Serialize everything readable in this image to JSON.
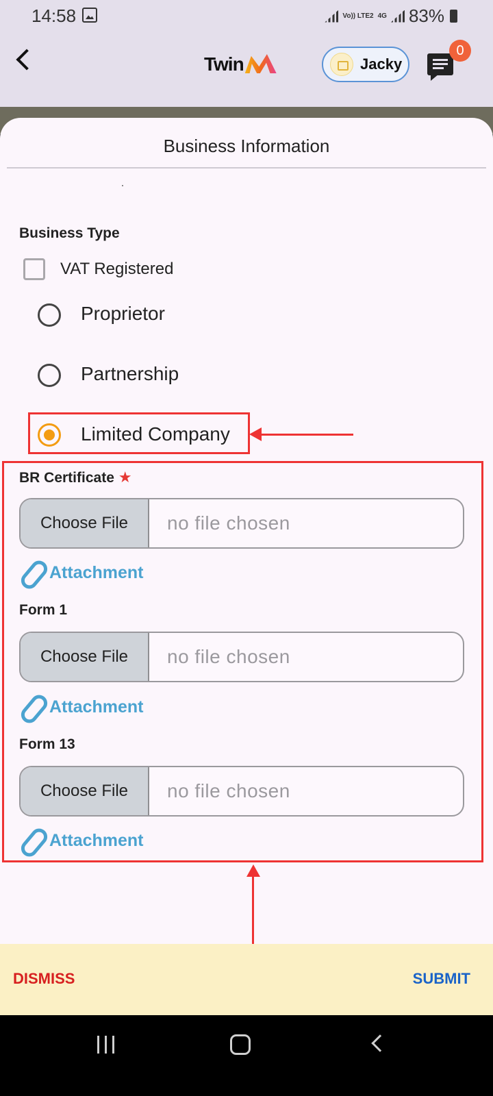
{
  "status_bar": {
    "time": "14:58",
    "network_1": "Vo)) LTE2",
    "network_2": "4G",
    "battery": "83%"
  },
  "app_bar": {
    "logo_text": "Twin",
    "user_name": "Jacky",
    "notification_count": "0"
  },
  "sheet": {
    "title": "Business Information",
    "business_type_label": "Business Type",
    "vat_label": "VAT Registered",
    "vat_checked": false,
    "options": [
      {
        "label": "Proprietor",
        "selected": false
      },
      {
        "label": "Partnership",
        "selected": false
      },
      {
        "label": "Limited Company",
        "selected": true
      }
    ],
    "files": [
      {
        "label": "BR Certificate",
        "required_marker": "★",
        "button": "Choose File",
        "status": "no file chosen",
        "attachment": "Attachment"
      },
      {
        "label": "Form 1",
        "button": "Choose File",
        "status": "no file chosen",
        "attachment": "Attachment"
      },
      {
        "label": "Form 13",
        "button": "Choose File",
        "status": "no file chosen",
        "attachment": "Attachment"
      }
    ]
  },
  "actions": {
    "dismiss": "DISMISS",
    "submit": "SUBMIT"
  },
  "colors": {
    "accent_orange": "#f39c12",
    "annotation_red": "#ee3333",
    "link_blue": "#4ba3d0",
    "dismiss_red": "#d72020",
    "submit_blue": "#1a63c8"
  }
}
